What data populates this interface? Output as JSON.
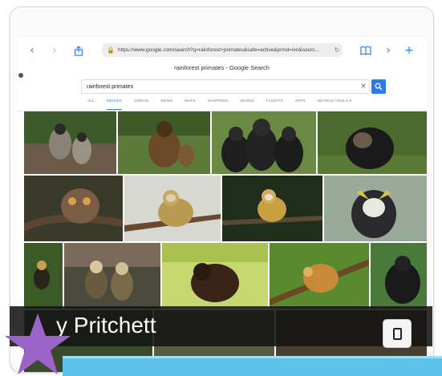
{
  "browser": {
    "url": "https://www.google.com/search?q=rainforest+primates&safe=active&prmd=ivn&sourc...",
    "page_title": "rainforest primates - Google Search"
  },
  "search": {
    "query": "rainforest primates",
    "clear_label": "×"
  },
  "tabs": [
    {
      "label": "ALL",
      "active": false
    },
    {
      "label": "IMAGES",
      "active": true
    },
    {
      "label": "VIDEOS",
      "active": false
    },
    {
      "label": "NEWS",
      "active": false
    },
    {
      "label": "MAPS",
      "active": false
    },
    {
      "label": "SHOPPING",
      "active": false
    },
    {
      "label": "BOOKS",
      "active": false
    },
    {
      "label": "FLIGHTS",
      "active": false
    },
    {
      "label": "APPS",
      "active": false
    },
    {
      "label": "SEARCH TOOLS ▾",
      "active": false
    }
  ],
  "icons": {
    "back": "chevron-left-icon",
    "forward": "chevron-right-icon",
    "share": "share-icon",
    "lock": "lock-icon",
    "reload": "reload-icon",
    "bookmarks": "book-icon",
    "more_forward": "chevron-right-icon",
    "add": "plus-icon",
    "search": "search-icon",
    "device": "tablet-icon"
  },
  "overlay": {
    "name": "y Pritchett"
  },
  "colors": {
    "accent": "#2b7ae8",
    "bottom_bar": "#5ec3ec",
    "star": "#9b64c8"
  }
}
